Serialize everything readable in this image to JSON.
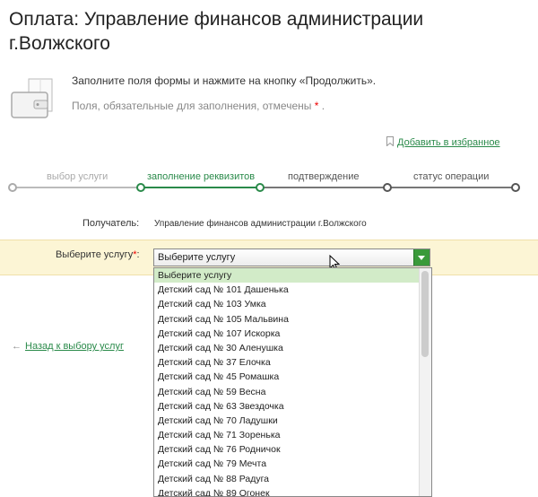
{
  "page": {
    "title": "Оплата: Управление финансов администрации г.Волжского",
    "hint": "Заполните поля формы и нажмите на кнопку «Продолжить».",
    "required_hint": "Поля, обязательные для заполнения, отмечены",
    "required_star": "*",
    "required_end": ".",
    "favorite_label": "Добавить в избранное"
  },
  "steps": [
    {
      "label": "выбор услуги",
      "state": "done"
    },
    {
      "label": "заполнение реквизитов",
      "state": "active"
    },
    {
      "label": "подтверждение",
      "state": "pending"
    },
    {
      "label": "статус операции",
      "state": "pending"
    }
  ],
  "form": {
    "recipient_label": "Получатель:",
    "recipient_value": "Управление финансов администрации г.Волжского",
    "service_label": "Выберите услугу",
    "service_star": "*",
    "service_colon": ":",
    "service_selected": "Выберите услугу",
    "options": [
      "Выберите услугу",
      "Детский сад № 101 Дашенька",
      "Детский сад № 103 Умка",
      "Детский сад № 105 Мальвина",
      "Детский сад № 107 Искорка",
      "Детский сад № 30 Аленушка",
      "Детский сад № 37 Елочка",
      "Детский сад № 45 Ромашка",
      "Детский сад № 59 Весна",
      "Детский сад № 63 Звездочка",
      "Детский сад № 70 Ладушки",
      "Детский сад № 71 Зоренька",
      "Детский сад № 76 Родничок",
      "Детский сад № 79 Мечта",
      "Детский сад № 88 Радуга",
      "Детский сад № 89 Огонек"
    ]
  },
  "nav": {
    "back_arrow": "←",
    "back_label": "Назад к выбору услуг"
  },
  "colors": {
    "accent_green": "#2a8a4a",
    "highlight": "#fcf5d5",
    "selected_option": "#d2ebc8"
  },
  "icons": [
    "wallet-icon",
    "bookmark-icon",
    "dropdown-arrow-icon",
    "mouse-cursor-icon"
  ]
}
